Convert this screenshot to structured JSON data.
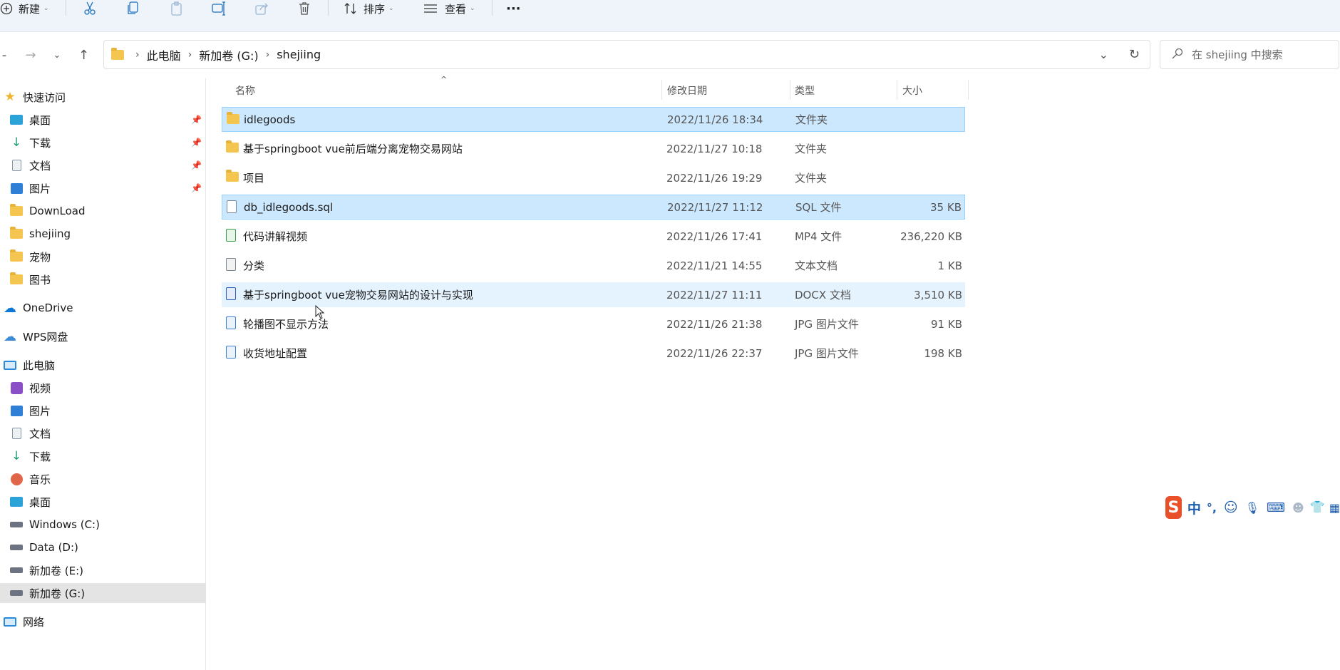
{
  "toolbar": {
    "new_label": "新建",
    "sort_label": "排序",
    "view_label": "查看",
    "more_label": "···"
  },
  "address": {
    "breadcrumbs": [
      "此电脑",
      "新加卷 (G:)",
      "shejiing"
    ],
    "search_placeholder": "在 shejiing 中搜索"
  },
  "sidebar": {
    "quick_access": "快速访问",
    "pinned": [
      {
        "label": "桌面",
        "icon": "desktop-icon"
      },
      {
        "label": "下载",
        "icon": "download-icon"
      },
      {
        "label": "文档",
        "icon": "document-icon"
      },
      {
        "label": "图片",
        "icon": "picture-icon"
      }
    ],
    "recent": [
      "DownLoad",
      "shejiing",
      "宠物",
      "图书"
    ],
    "onedrive": "OneDrive",
    "wps": "WPS网盘",
    "this_pc": "此电脑",
    "pc_items": [
      {
        "label": "视频",
        "icon": "video-icon"
      },
      {
        "label": "图片",
        "icon": "picture-icon"
      },
      {
        "label": "文档",
        "icon": "document-icon"
      },
      {
        "label": "下载",
        "icon": "download-icon"
      },
      {
        "label": "音乐",
        "icon": "music-icon"
      },
      {
        "label": "桌面",
        "icon": "desktop-icon"
      },
      {
        "label": "Windows (C:)",
        "icon": "drive-icon"
      },
      {
        "label": "Data (D:)",
        "icon": "drive-icon"
      },
      {
        "label": "新加卷 (E:)",
        "icon": "drive-icon"
      },
      {
        "label": "新加卷 (G:)",
        "icon": "drive-icon"
      }
    ],
    "network": "网络"
  },
  "columns": {
    "name": "名称",
    "date": "修改日期",
    "type": "类型",
    "size": "大小"
  },
  "files": [
    {
      "name": "idlegoods",
      "date": "2022/11/26 18:34",
      "type": "文件夹",
      "size": "",
      "icon": "folder-icon",
      "state": "selected"
    },
    {
      "name": "基于springboot vue前后端分离宠物交易网站",
      "date": "2022/11/27 10:18",
      "type": "文件夹",
      "size": "",
      "icon": "folder-icon",
      "state": ""
    },
    {
      "name": "项目",
      "date": "2022/11/26 19:29",
      "type": "文件夹",
      "size": "",
      "icon": "folder-icon",
      "state": ""
    },
    {
      "name": "db_idlegoods.sql",
      "date": "2022/11/27 11:12",
      "type": "SQL 文件",
      "size": "35 KB",
      "icon": "file-icon",
      "state": "selected"
    },
    {
      "name": "代码讲解视频",
      "date": "2022/11/26 17:41",
      "type": "MP4 文件",
      "size": "236,220 KB",
      "icon": "video-file-icon",
      "state": ""
    },
    {
      "name": "分类",
      "date": "2022/11/21 14:55",
      "type": "文本文档",
      "size": "1 KB",
      "icon": "text-file-icon",
      "state": ""
    },
    {
      "name": "基于springboot vue宠物交易网站的设计与实现",
      "date": "2022/11/27 11:11",
      "type": "DOCX 文档",
      "size": "3,510 KB",
      "icon": "word-file-icon",
      "state": "hover"
    },
    {
      "name": "轮播图不显示方法",
      "date": "2022/11/26 21:38",
      "type": "JPG 图片文件",
      "size": "91 KB",
      "icon": "image-file-icon",
      "state": ""
    },
    {
      "name": "收货地址配置",
      "date": "2022/11/26 22:37",
      "type": "JPG 图片文件",
      "size": "198 KB",
      "icon": "image-file-icon",
      "state": ""
    }
  ],
  "ime": {
    "logo": "S",
    "mode": "中",
    "punct": "°,"
  },
  "colors": {
    "selected_bg": "#cce8ff",
    "hover_bg": "#e5f3ff",
    "folder": "#f4c64f",
    "accent": "#0067c0"
  }
}
